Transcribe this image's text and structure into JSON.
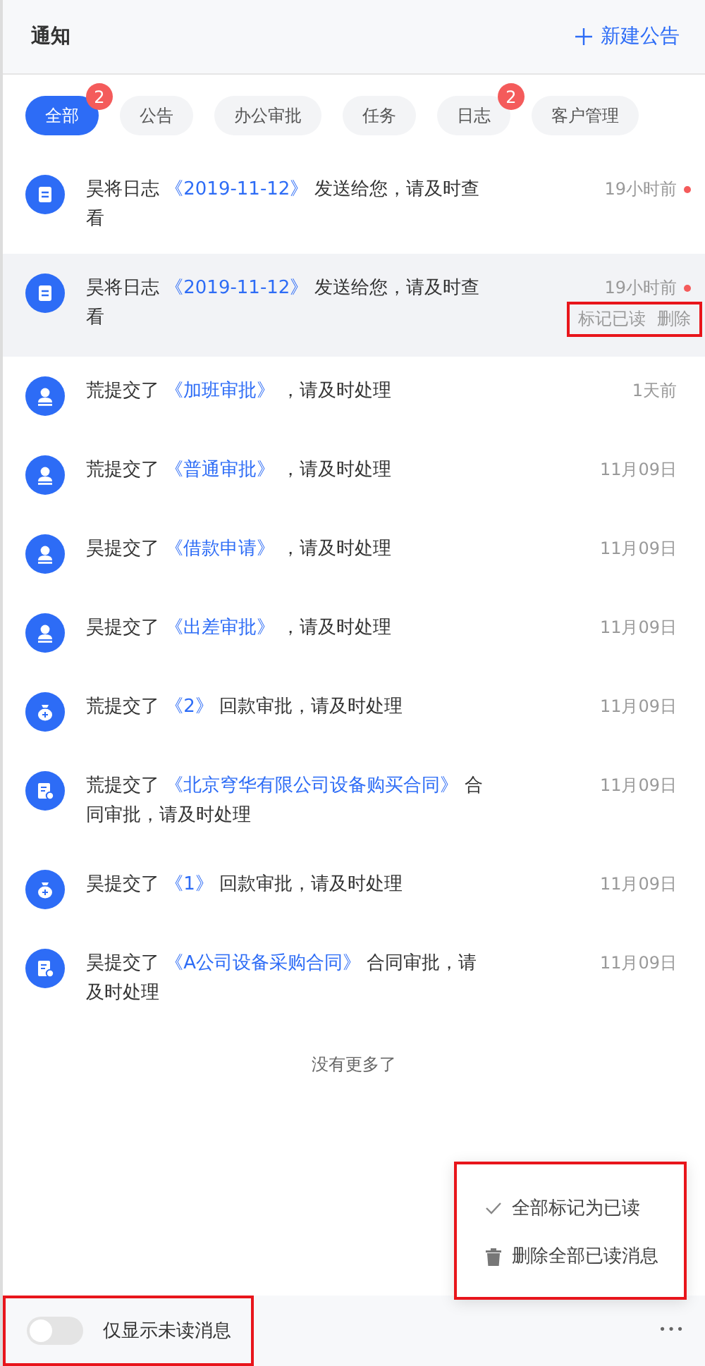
{
  "header": {
    "title": "通知",
    "new_button": "新建公告"
  },
  "tabs": [
    {
      "label": "全部",
      "selected": true,
      "badge": "2"
    },
    {
      "label": "公告",
      "selected": false
    },
    {
      "label": "办公审批",
      "selected": false
    },
    {
      "label": "任务",
      "selected": false
    },
    {
      "label": "日志",
      "selected": false,
      "badge": "2"
    },
    {
      "label": "客户管理",
      "selected": false
    }
  ],
  "notifications": [
    {
      "kind": "log",
      "prefix": "昊将日志",
      "link": "《2019-11-12》",
      "suffix": "发送给您，请及时查看",
      "time": "19小时前",
      "unread": true,
      "hovered": false
    },
    {
      "kind": "log",
      "prefix": "昊将日志",
      "link": "《2019-11-12》",
      "suffix": "发送给您，请及时查看",
      "time": "19小时前",
      "unread": true,
      "hovered": true,
      "actions": [
        "标记已读",
        "删除"
      ],
      "actions_highlighted": true
    },
    {
      "kind": "approval",
      "prefix": "荒提交了",
      "link": "《加班审批》",
      "suffix": "，请及时处理",
      "time": "1天前",
      "unread": false,
      "hovered": false
    },
    {
      "kind": "approval",
      "prefix": "荒提交了",
      "link": "《普通审批》",
      "suffix": "，请及时处理",
      "time": "11月09日",
      "unread": false,
      "hovered": false
    },
    {
      "kind": "approval",
      "prefix": "昊提交了",
      "link": "《借款申请》",
      "suffix": "，请及时处理",
      "time": "11月09日",
      "unread": false,
      "hovered": false
    },
    {
      "kind": "approval",
      "prefix": "昊提交了",
      "link": "《出差审批》",
      "suffix": "，请及时处理",
      "time": "11月09日",
      "unread": false,
      "hovered": false
    },
    {
      "kind": "payment",
      "prefix": "荒提交了",
      "link": "《2》",
      "suffix": "回款审批，请及时处理",
      "time": "11月09日",
      "unread": false,
      "hovered": false
    },
    {
      "kind": "contract",
      "prefix": "荒提交了",
      "link": "《北京穹华有限公司设备购买合同》",
      "suffix": "合同审批，请及时处理",
      "time": "11月09日",
      "unread": false,
      "hovered": false
    },
    {
      "kind": "payment",
      "prefix": "昊提交了",
      "link": "《1》",
      "suffix": "回款审批，请及时处理",
      "time": "11月09日",
      "unread": false,
      "hovered": false
    },
    {
      "kind": "contract",
      "prefix": "昊提交了",
      "link": "《A公司设备采购合同》",
      "suffix": "合同审批，请及时处理",
      "time": "11月09日",
      "unread": false,
      "hovered": false
    }
  ],
  "end_note": "没有更多了",
  "menu": {
    "highlighted": true,
    "items": [
      {
        "kind": "check",
        "label": "全部标记为已读"
      },
      {
        "kind": "trash",
        "label": "删除全部已读消息"
      }
    ]
  },
  "footer": {
    "toggle_on": false,
    "toggle_label": "仅显示未读消息",
    "highlighted": true,
    "more": "•••"
  }
}
